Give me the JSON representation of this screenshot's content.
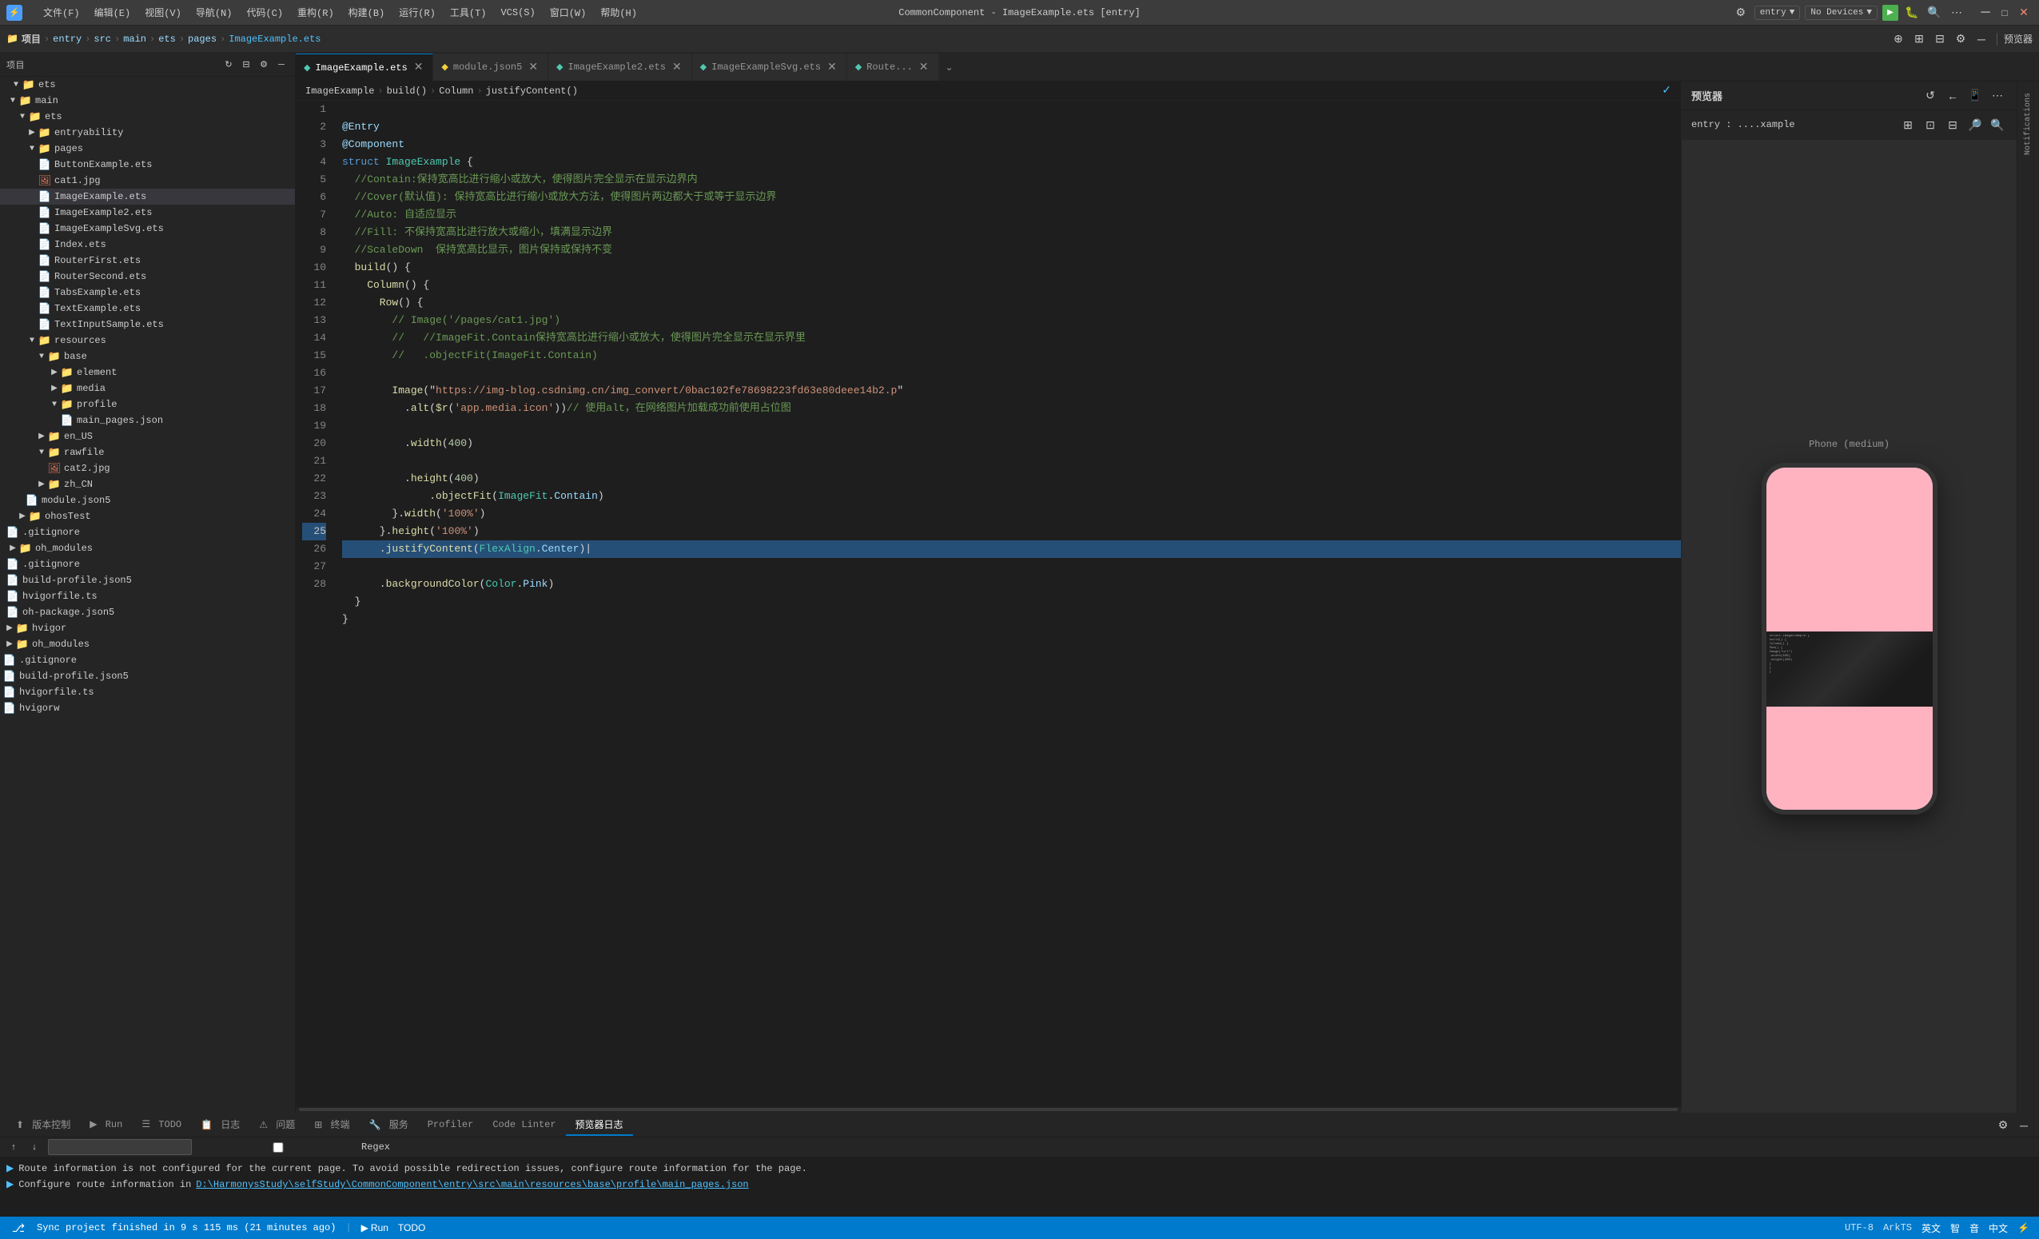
{
  "title_bar": {
    "app_icon": "⚡",
    "menu_items": [
      "文件(F)",
      "编辑(E)",
      "视图(V)",
      "导航(N)",
      "代码(C)",
      "重构(R)",
      "构建(B)",
      "运行(R)",
      "工具(T)",
      "VCS(S)",
      "窗口(W)",
      "帮助(H)"
    ],
    "window_title": "CommonComponent - ImageExample.ets [entry]",
    "device_label": "No Devices",
    "entry_label": "entry",
    "preview_label": "预览器"
  },
  "second_bar": {
    "project_label": "项目",
    "breadcrumb": [
      "entry",
      "src",
      "main",
      "ets",
      "pages",
      "ImageExample.ets"
    ]
  },
  "sidebar": {
    "title": "项目",
    "tree": [
      {
        "id": "ets",
        "label": "ets",
        "type": "folder",
        "indent": 2,
        "expanded": true
      },
      {
        "id": "main",
        "label": "main",
        "type": "folder",
        "indent": 1,
        "expanded": true
      },
      {
        "id": "ets2",
        "label": "ets",
        "type": "folder",
        "indent": 2,
        "expanded": true
      },
      {
        "id": "entryability",
        "label": "entryability",
        "type": "folder",
        "indent": 3,
        "expanded": false
      },
      {
        "id": "pages",
        "label": "pages",
        "type": "folder",
        "indent": 3,
        "expanded": true
      },
      {
        "id": "ButtonExample",
        "label": "ButtonExample.ets",
        "type": "file-ets",
        "indent": 4
      },
      {
        "id": "cat1",
        "label": "cat1.jpg",
        "type": "file-jpg",
        "indent": 4
      },
      {
        "id": "ImageExample",
        "label": "ImageExample.ets",
        "type": "file-ets",
        "indent": 4,
        "active": true
      },
      {
        "id": "ImageExample2",
        "label": "ImageExample2.ets",
        "type": "file-ets",
        "indent": 4
      },
      {
        "id": "ImageExampleSvg",
        "label": "ImageExampleSvg.ets",
        "type": "file-ets",
        "indent": 4
      },
      {
        "id": "Index",
        "label": "Index.ets",
        "type": "file-ets",
        "indent": 4
      },
      {
        "id": "RouterFirst",
        "label": "RouterFirst.ets",
        "type": "file-ets",
        "indent": 4
      },
      {
        "id": "RouterSecond",
        "label": "RouterSecond.ets",
        "type": "file-ets",
        "indent": 4
      },
      {
        "id": "TabsExample",
        "label": "TabsExample.ets",
        "type": "file-ets",
        "indent": 4
      },
      {
        "id": "TextExample",
        "label": "TextExample.ets",
        "type": "file-ets",
        "indent": 4
      },
      {
        "id": "TextInputSample",
        "label": "TextInputSample.ets",
        "type": "file-ets",
        "indent": 4
      },
      {
        "id": "resources",
        "label": "resources",
        "type": "folder",
        "indent": 3,
        "expanded": true
      },
      {
        "id": "base",
        "label": "base",
        "type": "folder",
        "indent": 4,
        "expanded": true
      },
      {
        "id": "element",
        "label": "element",
        "type": "folder",
        "indent": 5,
        "expanded": false
      },
      {
        "id": "media",
        "label": "media",
        "type": "folder",
        "indent": 5,
        "expanded": false
      },
      {
        "id": "profile",
        "label": "profile",
        "type": "folder",
        "indent": 5,
        "expanded": true
      },
      {
        "id": "main_pages",
        "label": "main_pages.json",
        "type": "file-json",
        "indent": 6
      },
      {
        "id": "en_US",
        "label": "en_US",
        "type": "folder",
        "indent": 4,
        "expanded": false
      },
      {
        "id": "rawfile",
        "label": "rawfile",
        "type": "folder",
        "indent": 4,
        "expanded": true
      },
      {
        "id": "cat2",
        "label": "cat2.jpg",
        "type": "file-jpg",
        "indent": 5
      },
      {
        "id": "zh_CN",
        "label": "zh_CN",
        "type": "folder",
        "indent": 4,
        "expanded": false
      },
      {
        "id": "module_json",
        "label": "module.json5",
        "type": "file-json",
        "indent": 3
      },
      {
        "id": "ohosTest",
        "label": "ohosTest",
        "type": "folder",
        "indent": 2,
        "expanded": false
      },
      {
        "id": "gitignore",
        "label": ".gitignore",
        "type": "file",
        "indent": 1
      },
      {
        "id": "oh_modules",
        "label": "oh_modules",
        "type": "folder",
        "indent": 1,
        "expanded": false
      },
      {
        "id": "gitignore2",
        "label": ".gitignore",
        "type": "file",
        "indent": 1
      },
      {
        "id": "build_profile",
        "label": "build-profile.json5",
        "type": "file-json",
        "indent": 1
      },
      {
        "id": "hvigorfile",
        "label": "hvigorfile.ts",
        "type": "file-ts",
        "indent": 1
      },
      {
        "id": "oh_package",
        "label": "oh-package.json5",
        "type": "file-json",
        "indent": 1
      },
      {
        "id": "hvigor",
        "label": "hvigor",
        "type": "folder",
        "indent": 0,
        "expanded": false
      },
      {
        "id": "oh_modules2",
        "label": "oh_modules",
        "type": "folder",
        "indent": 0,
        "expanded": false
      },
      {
        "id": "gitignore3",
        "label": ".gitignore",
        "type": "file",
        "indent": 0
      },
      {
        "id": "build_profile2",
        "label": "build-profile.json5",
        "type": "file-json",
        "indent": 0
      },
      {
        "id": "hvigorfile2",
        "label": "hvigorfile.ts",
        "type": "file-ts",
        "indent": 0
      },
      {
        "id": "hvigorw",
        "label": "hvigorw",
        "type": "file",
        "indent": 0
      }
    ]
  },
  "tabs": {
    "items": [
      {
        "label": "ImageExample.ets",
        "active": true,
        "dirty": false
      },
      {
        "label": "module.json5",
        "active": false,
        "dirty": false
      },
      {
        "label": "ImageExample2.ets",
        "active": false,
        "dirty": false
      },
      {
        "label": "ImageExampleSvg.ets",
        "active": false,
        "dirty": false
      },
      {
        "label": "Route...",
        "active": false,
        "dirty": false
      }
    ],
    "more": "⌄"
  },
  "editor": {
    "filename": "ImageExample.ets",
    "breadcrumb": [
      "ImageExample",
      "build()",
      "Column",
      "justifyContent()"
    ],
    "lines": [
      {
        "num": 1,
        "tokens": [
          {
            "t": "deco",
            "v": "@Entry"
          }
        ]
      },
      {
        "num": 2,
        "tokens": [
          {
            "t": "deco",
            "v": "@Component"
          }
        ]
      },
      {
        "num": 3,
        "tokens": [
          {
            "t": "kw",
            "v": "struct "
          },
          {
            "t": "type",
            "v": "ImageExample"
          },
          {
            "t": "punc",
            "v": " {"
          }
        ]
      },
      {
        "num": 4,
        "tokens": [
          {
            "t": "cm",
            "v": "  //Contain:保持宽高比进行缩小或放大，使得图片完全显示在显示边界内"
          }
        ]
      },
      {
        "num": 5,
        "tokens": [
          {
            "t": "cm",
            "v": "  //Cover(默认值): 保持宽高比进行缩小或放大方法，使得图片两边都大于或等于显示边界"
          }
        ]
      },
      {
        "num": 6,
        "tokens": [
          {
            "t": "cm",
            "v": "  //Auto: 自适应显示"
          }
        ]
      },
      {
        "num": 7,
        "tokens": [
          {
            "t": "cm",
            "v": "  //Fill: 不保持宽高比进行放大或缩小，填满显示边界"
          }
        ]
      },
      {
        "num": 8,
        "tokens": [
          {
            "t": "cm",
            "v": "  //ScaleDown  保持宽高比显示，图片保持或保持不变"
          }
        ]
      },
      {
        "num": 9,
        "tokens": [
          {
            "t": "fn",
            "v": "  build"
          },
          {
            "t": "punc",
            "v": "() {"
          }
        ]
      },
      {
        "num": 10,
        "tokens": [
          {
            "t": "fn",
            "v": "    Column"
          },
          {
            "t": "punc",
            "v": "() {"
          }
        ]
      },
      {
        "num": 11,
        "tokens": [
          {
            "t": "fn",
            "v": "      Row"
          },
          {
            "t": "punc",
            "v": "() {"
          }
        ]
      },
      {
        "num": 12,
        "tokens": [
          {
            "t": "cm",
            "v": "        // Image('/pages/cat1.jpg')"
          }
        ]
      },
      {
        "num": 13,
        "tokens": [
          {
            "t": "cm",
            "v": "        //   //ImageFit.Contain保持宽高比进行缩小或放大，使得图片完全显示在显示界里"
          }
        ]
      },
      {
        "num": 14,
        "tokens": [
          {
            "t": "cm",
            "v": "        //   .objectFit(ImageFit.Contain)"
          }
        ]
      },
      {
        "num": 15,
        "tokens": []
      },
      {
        "num": 16,
        "tokens": [
          {
            "t": "fn",
            "v": "        Image"
          },
          {
            "t": "punc",
            "v": "(\""
          },
          {
            "t": "str",
            "v": "https://img-blog.csdnimg.cn/img_convert/0bac102fe78698223fd63e80deee14b2.p"
          },
          {
            "t": "punc",
            "v": "\""
          }
        ]
      },
      {
        "num": 17,
        "tokens": [
          {
            "t": "punc",
            "v": "          ."
          },
          {
            "t": "fn",
            "v": "alt"
          },
          {
            "t": "punc",
            "v": "("
          },
          {
            "t": "fn",
            "v": "$r"
          },
          {
            "t": "punc",
            "v": "("
          },
          {
            "t": "str",
            "v": "'app.media.icon'"
          },
          {
            "t": "punc",
            "v": "))"
          },
          {
            "t": "cm",
            "v": "// 使用alt，在网络图片加载成功前使用占位图"
          }
        ]
      },
      {
        "num": 18,
        "tokens": []
      },
      {
        "num": 19,
        "tokens": [
          {
            "t": "punc",
            "v": "          ."
          },
          {
            "t": "fn",
            "v": "width"
          },
          {
            "t": "punc",
            "v": "("
          },
          {
            "t": "num",
            "v": "400"
          },
          {
            "t": "punc",
            "v": ")"
          }
        ]
      },
      {
        "num": 20,
        "tokens": []
      },
      {
        "num": 21,
        "tokens": [
          {
            "t": "punc",
            "v": "          ."
          },
          {
            "t": "fn",
            "v": "height"
          },
          {
            "t": "punc",
            "v": "("
          },
          {
            "t": "num",
            "v": "400"
          },
          {
            "t": "punc",
            "v": ")"
          }
        ]
      },
      {
        "num": 22,
        "tokens": [
          {
            "t": "punc",
            "v": "              ."
          },
          {
            "t": "fn",
            "v": "objectFit"
          },
          {
            "t": "punc",
            "v": "("
          },
          {
            "t": "type",
            "v": "ImageFit"
          },
          {
            "t": "punc",
            "v": "."
          },
          {
            "t": "prop",
            "v": "Contain"
          },
          {
            "t": "punc",
            "v": ")"
          }
        ]
      },
      {
        "num": 23,
        "tokens": [
          {
            "t": "punc",
            "v": "        }."
          },
          {
            "t": "fn",
            "v": "width"
          },
          {
            "t": "punc",
            "v": "("
          },
          {
            "t": "str",
            "v": "'100%'"
          },
          {
            "t": "punc",
            "v": ")"
          }
        ]
      },
      {
        "num": 24,
        "tokens": [
          {
            "t": "punc",
            "v": "      }."
          },
          {
            "t": "fn",
            "v": "height"
          },
          {
            "t": "punc",
            "v": "("
          },
          {
            "t": "str",
            "v": "'100%'"
          },
          {
            "t": "punc",
            "v": ")"
          }
        ]
      },
      {
        "num": 25,
        "tokens": [
          {
            "t": "punc",
            "v": "      ."
          },
          {
            "t": "fn",
            "v": "justifyContent"
          },
          {
            "t": "punc",
            "v": "("
          },
          {
            "t": "type",
            "v": "FlexAlign"
          },
          {
            "t": "punc",
            "v": "."
          },
          {
            "t": "prop",
            "v": "Center"
          },
          {
            "t": "punc",
            "v": ")"
          }
        ],
        "highlight": true
      },
      {
        "num": 26,
        "tokens": [
          {
            "t": "punc",
            "v": "      ."
          },
          {
            "t": "fn",
            "v": "backgroundColor"
          },
          {
            "t": "punc",
            "v": "("
          },
          {
            "t": "type",
            "v": "Color"
          },
          {
            "t": "punc",
            "v": "."
          },
          {
            "t": "prop",
            "v": "Pink"
          },
          {
            "t": "punc",
            "v": ")"
          }
        ]
      },
      {
        "num": 27,
        "tokens": [
          {
            "t": "punc",
            "v": "  }"
          }
        ]
      },
      {
        "num": 28,
        "tokens": [
          {
            "t": "punc",
            "v": "}"
          }
        ]
      }
    ]
  },
  "preview": {
    "title": "预览器",
    "entry_path": "entry : ....xample",
    "phone_label": "Phone (medium)",
    "image_top_color": "#ffb3c1",
    "image_bottom_color": "#ffb3c1"
  },
  "bottom_panel": {
    "tabs": [
      "预览器日志",
      "版本控制",
      "Run",
      "TODO",
      "日志",
      "问题",
      "终端",
      "服务",
      "Profiler",
      "Code Linter",
      "预览器日志"
    ],
    "active_tab": "预览器日志",
    "search_placeholder": "",
    "regex_label": "Regex",
    "log_lines": [
      "Route information is not configured for the current page. To avoid possible redirection issues, configure route information for the page.",
      "Configure route information in D:\\HarmonysStudy\\selfStudy\\CommonComponent\\entry\\src\\main\\resources\\base\\profile\\main_pages.json"
    ]
  },
  "status_bar": {
    "sync_msg": "Sync project finished in 9 s 115 ms (21 minutes ago)",
    "run_label": "Run",
    "todo_label": "TODO",
    "right_items": [
      "版本控制",
      "英文",
      "智",
      "音",
      "中文",
      "⚡"
    ]
  }
}
